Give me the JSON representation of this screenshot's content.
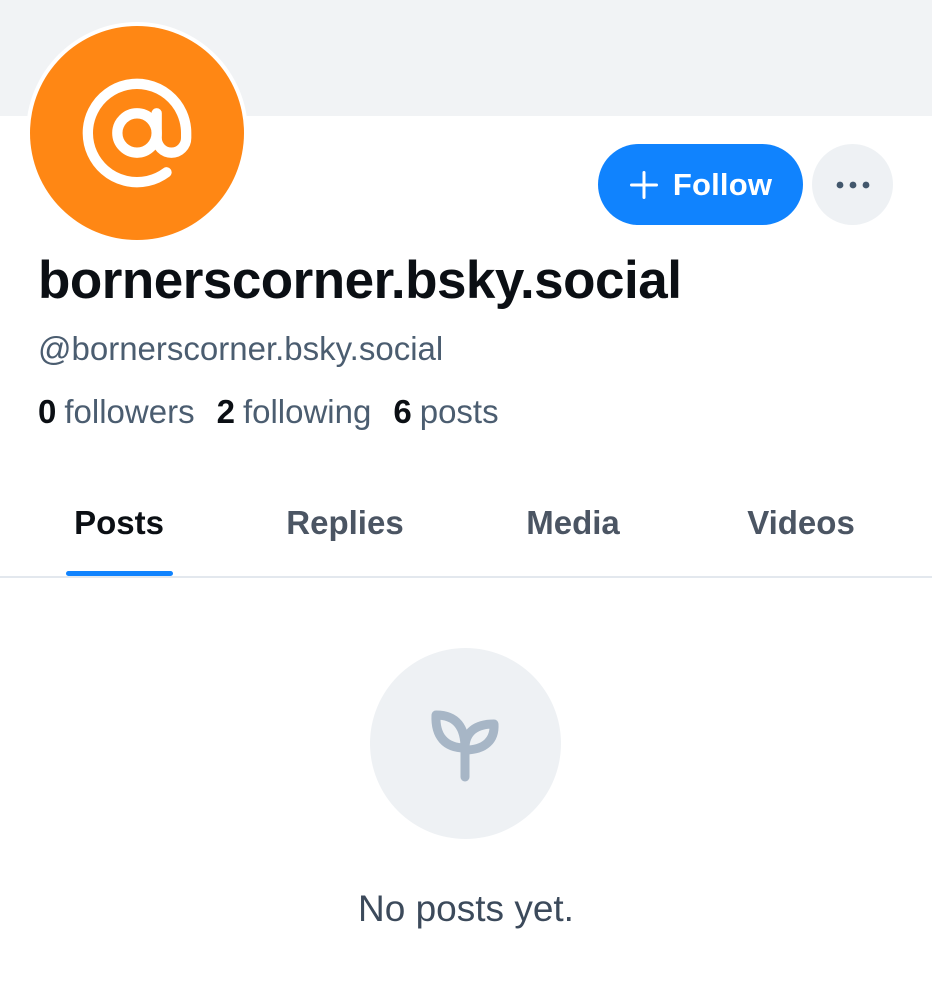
{
  "profile": {
    "display_name": "bornerscorner.bsky.social",
    "handle": "@bornerscorner.bsky.social",
    "avatar_icon": "at-sign-icon",
    "avatar_color": "#ff8714"
  },
  "actions": {
    "follow_label": "Follow",
    "follow_color": "#1083fe",
    "more_icon": "ellipsis-icon"
  },
  "stats": {
    "followers_count": "0",
    "followers_label": "followers",
    "following_count": "2",
    "following_label": "following",
    "posts_count": "6",
    "posts_label": "posts"
  },
  "tabs": [
    {
      "label": "Posts",
      "active": true
    },
    {
      "label": "Replies",
      "active": false
    },
    {
      "label": "Media",
      "active": false
    },
    {
      "label": "Videos",
      "active": false
    }
  ],
  "empty_state": {
    "icon": "sprout-icon",
    "message": "No posts yet."
  }
}
